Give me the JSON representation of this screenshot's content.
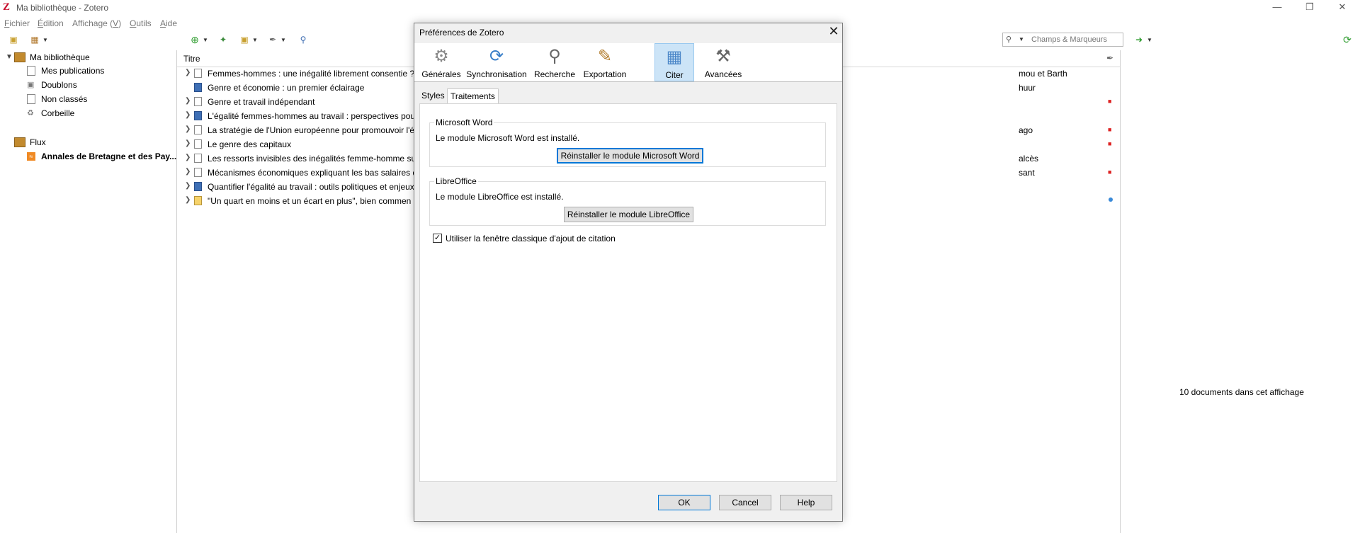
{
  "window": {
    "title": "Ma bibliothèque - Zotero",
    "app_icon": "Z"
  },
  "menu": [
    {
      "pre": "",
      "u": "F",
      "post": "ichier"
    },
    {
      "pre": "",
      "u": "É",
      "post": "dition"
    },
    {
      "pre": "Affichage (",
      "u": "V",
      "post": ")"
    },
    {
      "pre": "",
      "u": "O",
      "post": "utils"
    },
    {
      "pre": "",
      "u": "A",
      "post": "ide"
    }
  ],
  "search": {
    "placeholder": "Champs & Marqueurs"
  },
  "library": {
    "root": "Ma bibliothèque",
    "items": [
      "Mes publications",
      "Doublons",
      "Non classés",
      "Corbeille"
    ],
    "feeds_label": "Flux",
    "feed_item": "Annales de Bretagne et des Pay..."
  },
  "columns": {
    "title": "Titre"
  },
  "items": [
    {
      "title": "Femmes-hommes : une inégalité librement consentie ?",
      "creator": "mou et Barth",
      "kind": "doc"
    },
    {
      "title": "Genre et économie : un premier éclairage",
      "creator": "huur",
      "kind": "book"
    },
    {
      "title": "Genre et travail indépendant",
      "creator": "",
      "kind": "doc"
    },
    {
      "title": "L'égalité femmes-hommes au travail : perspectives pou",
      "creator": "",
      "kind": "book"
    },
    {
      "title": "La stratégie de l'Union européenne pour promouvoir l'é",
      "creator": "ago",
      "kind": "doc"
    },
    {
      "title": "Le genre des capitaux",
      "creator": "",
      "kind": "doc"
    },
    {
      "title": "Les ressorts invisibles des inégalités femme-homme sur",
      "creator": "alcès",
      "kind": "doc"
    },
    {
      "title": "Mécanismes économiques expliquant les bas salaires d",
      "creator": "sant",
      "kind": "doc"
    },
    {
      "title": "Quantifier l'égalité au travail : outils politiques et enjeux",
      "creator": "",
      "kind": "book"
    },
    {
      "title": "\"Un quart en moins et un écart en plus\", bien commen",
      "creator": "",
      "kind": "note"
    }
  ],
  "status": {
    "count": "10 documents dans cet affichage"
  },
  "dialog": {
    "title": "Préférences de Zotero",
    "panes": [
      "Générales",
      "Synchronisation",
      "Recherche",
      "Exportation",
      "Citer",
      "Avancées"
    ],
    "subtabs": [
      "Styles",
      "Traitements de texte"
    ],
    "word": {
      "legend": "Microsoft Word",
      "status": "Le module Microsoft Word est installé.",
      "button": "Réinstaller le module Microsoft Word"
    },
    "libre": {
      "legend": "LibreOffice",
      "status": "Le module LibreOffice est installé.",
      "button": "Réinstaller le module LibreOffice"
    },
    "classic_checkbox": "Utiliser la fenêtre classique d'ajout de citation",
    "ok": "OK",
    "cancel": "Cancel",
    "help": "Help"
  }
}
